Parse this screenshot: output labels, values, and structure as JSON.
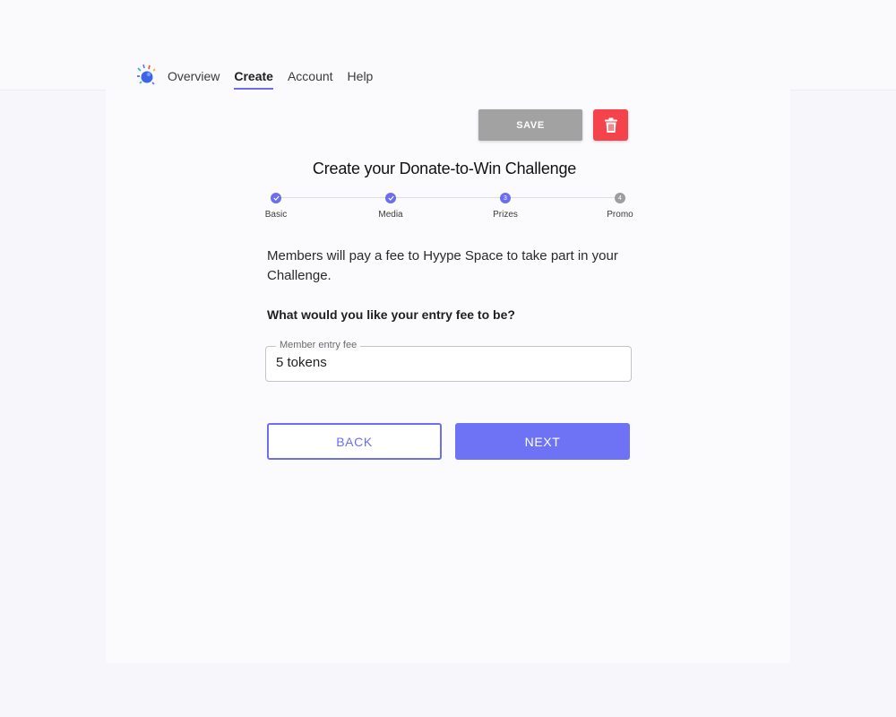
{
  "nav": {
    "items": [
      {
        "label": "Overview",
        "active": false
      },
      {
        "label": "Create",
        "active": true
      },
      {
        "label": "Account",
        "active": false
      },
      {
        "label": "Help",
        "active": false
      }
    ]
  },
  "toolbar": {
    "save_label": "SAVE",
    "delete_icon": "trash-icon"
  },
  "page": {
    "title": "Create your Donate-to-Win Challenge"
  },
  "stepper": {
    "steps": [
      {
        "label": "Basic",
        "state": "complete",
        "marker": "check-icon"
      },
      {
        "label": "Media",
        "state": "complete",
        "marker": "check-icon"
      },
      {
        "label": "Prizes",
        "state": "active",
        "marker": "3"
      },
      {
        "label": "Promo",
        "state": "pending",
        "marker": "4"
      }
    ]
  },
  "content": {
    "intro": "Members will pay a fee to Hyype Space to take part in your Challenge.",
    "question": "What would you like your entry fee to be?"
  },
  "entry_fee": {
    "label": "Member entry fee",
    "value": "5 tokens"
  },
  "actions": {
    "back_label": "BACK",
    "next_label": "NEXT"
  },
  "colors": {
    "accent": "#6e72f4",
    "save_disabled": "#a2a2a2",
    "delete": "#f4434a",
    "step_complete": "#6c6ef0",
    "step_pending": "#9e9e9e"
  }
}
